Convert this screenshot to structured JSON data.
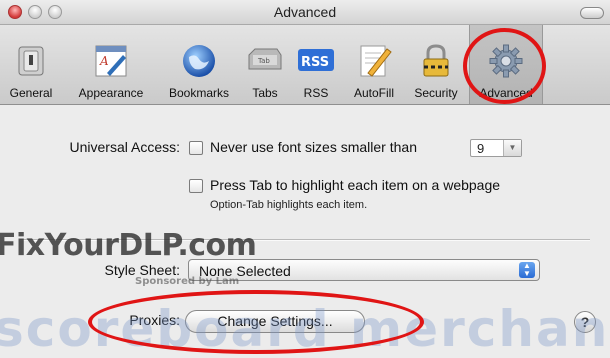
{
  "window": {
    "title": "Advanced"
  },
  "toolbar": {
    "items": [
      {
        "label": "General",
        "icon": "general-switch-icon"
      },
      {
        "label": "Appearance",
        "icon": "appearance-icon"
      },
      {
        "label": "Bookmarks",
        "icon": "globe-icon"
      },
      {
        "label": "Tabs",
        "icon": "tabs-icon"
      },
      {
        "label": "RSS",
        "icon": "rss-icon"
      },
      {
        "label": "AutoFill",
        "icon": "autofill-pencil-icon"
      },
      {
        "label": "Security",
        "icon": "lock-icon"
      },
      {
        "label": "Advanced",
        "icon": "gear-icon"
      }
    ],
    "selected": "Advanced",
    "tabs_icon_text": "Tab",
    "rss_icon_text": "RSS"
  },
  "universal_access": {
    "label": "Universal Access:",
    "min_font_checkbox_label": "Never use font sizes smaller than",
    "min_font_value": "9",
    "tab_checkbox_label": "Press Tab to highlight each item on a webpage",
    "tab_hint": "Option-Tab highlights each item."
  },
  "style_sheet": {
    "label": "Style Sheet:",
    "value": "None Selected"
  },
  "proxies": {
    "label": "Proxies:",
    "button_label": "Change Settings..."
  },
  "help": {
    "label": "?"
  },
  "watermarks": {
    "primary": "FixYourDLP.com",
    "secondary": "Sponsored by Lam",
    "tertiary": "scoreboard merchan"
  },
  "colors": {
    "annotation": "#e01515",
    "popup_arrow": "#2a6bd4"
  }
}
